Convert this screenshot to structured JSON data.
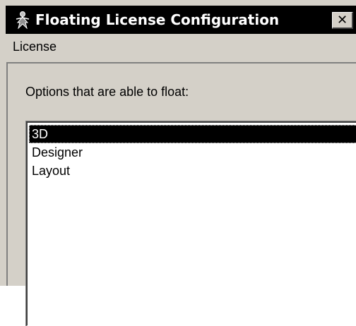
{
  "window": {
    "title": "Floating License Configuration",
    "close_glyph": "✕",
    "icon": "license-figure-icon"
  },
  "menu": {
    "items": [
      {
        "label": "License"
      }
    ]
  },
  "main": {
    "options_label": "Options that are able to float:",
    "list": {
      "items": [
        {
          "label": "3D",
          "selected": true
        },
        {
          "label": "Designer",
          "selected": false
        },
        {
          "label": "Layout",
          "selected": false
        }
      ]
    }
  },
  "colors": {
    "titlebar_bg": "#000000",
    "window_bg": "#d4d0c8",
    "selection_bg": "#000000",
    "selection_fg": "#ffffff"
  }
}
